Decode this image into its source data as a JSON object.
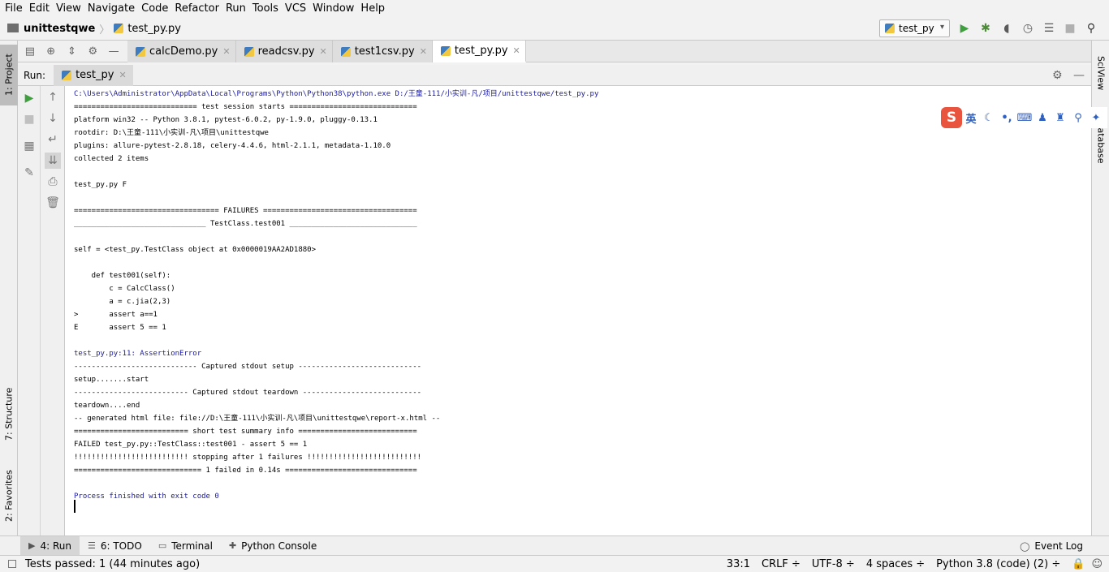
{
  "menu": [
    "File",
    "Edit",
    "View",
    "Navigate",
    "Code",
    "Refactor",
    "Run",
    "Tools",
    "VCS",
    "Window",
    "Help"
  ],
  "breadcrumb": {
    "project": "unittestqwe",
    "file": "test_py.py"
  },
  "run_config": "test_py",
  "tool_windows": {
    "left_top": "1: Project",
    "left_structure": "7: Structure",
    "left_favorites": "2: Favorites",
    "right_top": "SciView",
    "right_db": "Database"
  },
  "editor_tabs": [
    {
      "label": "calcDemo.py",
      "active": false
    },
    {
      "label": "readcsv.py",
      "active": false
    },
    {
      "label": "test1csv.py",
      "active": false
    },
    {
      "label": "test_py.py",
      "active": true
    }
  ],
  "run_panel": {
    "label": "Run:",
    "tab": "test_py"
  },
  "console_lines": [
    {
      "text": "C:\\Users\\Administrator\\AppData\\Local\\Programs\\Python\\Python38\\python.exe D:/王童-111/小实训-凡/项目/unittestqwe/test_py.py",
      "blue": true
    },
    {
      "text": "============================ test session starts =============================",
      "blue": false
    },
    {
      "text": "platform win32 -- Python 3.8.1, pytest-6.0.2, py-1.9.0, pluggy-0.13.1",
      "blue": false
    },
    {
      "text": "rootdir: D:\\王童-111\\小实训-凡\\项目\\unittestqwe",
      "blue": false
    },
    {
      "text": "plugins: allure-pytest-2.8.18, celery-4.4.6, html-2.1.1, metadata-1.10.0",
      "blue": false
    },
    {
      "text": "collected 2 items",
      "blue": false
    },
    {
      "text": "",
      "blue": false
    },
    {
      "text": "test_py.py F",
      "blue": false
    },
    {
      "text": "",
      "blue": false
    },
    {
      "text": "================================= FAILURES ===================================",
      "blue": false
    },
    {
      "text": "______________________________ TestClass.test001 _____________________________",
      "blue": false
    },
    {
      "text": "",
      "blue": false
    },
    {
      "text": "self = <test_py.TestClass object at 0x0000019AA2AD1880>",
      "blue": false
    },
    {
      "text": "",
      "blue": false
    },
    {
      "text": "    def test001(self):",
      "blue": false
    },
    {
      "text": "        c = CalcClass()",
      "blue": false
    },
    {
      "text": "        a = c.jia(2,3)",
      "blue": false
    },
    {
      "text": ">       assert a==1",
      "blue": false
    },
    {
      "text": "E       assert 5 == 1",
      "blue": false
    },
    {
      "text": "",
      "blue": false
    },
    {
      "text": "test_py.py:11: AssertionError",
      "blue": true
    },
    {
      "text": "---------------------------- Captured stdout setup ----------------------------",
      "blue": false
    },
    {
      "text": "setup.......start",
      "blue": false
    },
    {
      "text": "-------------------------- Captured stdout teardown ---------------------------",
      "blue": false
    },
    {
      "text": "teardown....end",
      "blue": false
    },
    {
      "text": "-- generated html file: file://D:\\王童-111\\小实训-凡\\项目\\unittestqwe\\report-x.html --",
      "blue": false
    },
    {
      "text": "========================== short test summary info ===========================",
      "blue": false
    },
    {
      "text": "FAILED test_py.py::TestClass::test001 - assert 5 == 1",
      "blue": false
    },
    {
      "text": "!!!!!!!!!!!!!!!!!!!!!!!!!! stopping after 1 failures !!!!!!!!!!!!!!!!!!!!!!!!!!",
      "blue": false
    },
    {
      "text": "============================= 1 failed in 0.14s ==============================",
      "blue": false
    },
    {
      "text": "",
      "blue": false
    },
    {
      "text": "Process finished with exit code 0",
      "blue": true
    }
  ],
  "ime": {
    "logo": "S",
    "lang": "英"
  },
  "bottom_tabs": [
    {
      "label": "4: Run",
      "active": true
    },
    {
      "label": "6: TODO",
      "active": false
    },
    {
      "label": "Terminal",
      "active": false
    },
    {
      "label": "Python Console",
      "active": false
    }
  ],
  "event_log": "Event Log",
  "status": {
    "message": "Tests passed: 1 (44 minutes ago)",
    "position": "33:1",
    "line_sep": "CRLF ÷",
    "encoding": "UTF-8 ÷",
    "indent": "4 spaces ÷",
    "interpreter": "Python 3.8 (code) (2) ÷"
  },
  "colors": {
    "console_blue": "#1a1aa6",
    "run_green": "#3f9f3f",
    "ime_red": "#e8543d"
  }
}
